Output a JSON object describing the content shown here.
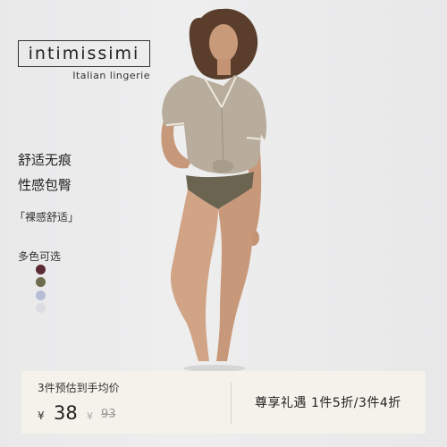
{
  "brand": {
    "name": "intimissimi",
    "tagline": "Italian lingerie"
  },
  "features": [
    "舒适无痕",
    "性感包臀"
  ],
  "tag": "「裸感舒适」",
  "colors_label": "多色可选",
  "color_swatches": [
    "#5c2a35",
    "#6e6b4f",
    "#b8bcd6",
    "#dcdce3"
  ],
  "price_bar": {
    "title": "3件预估到手均价",
    "currency": "¥",
    "price": "38",
    "original_currency": "¥",
    "original_price": "93",
    "promo": "尊享礼遇 1件5折/3件4折"
  }
}
